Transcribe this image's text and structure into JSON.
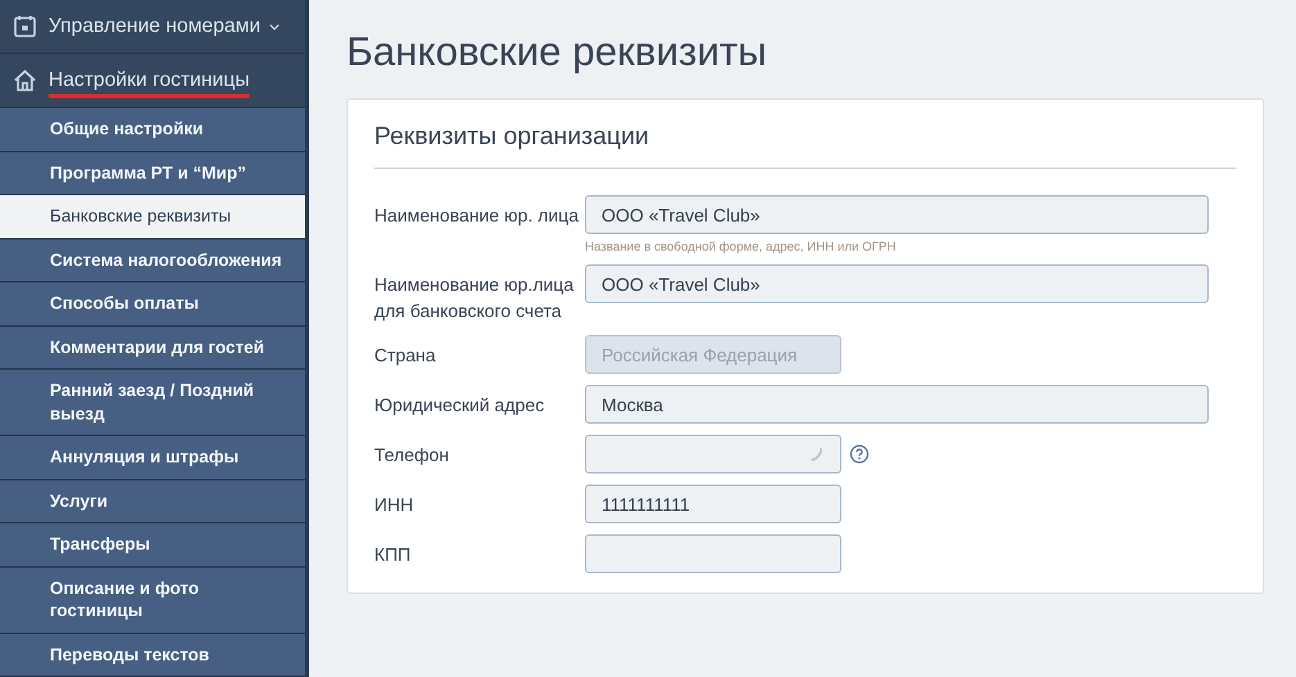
{
  "sidebar": {
    "sections": [
      {
        "label": "Управление номерами",
        "kind": "rooms",
        "expanded": false,
        "active": false
      },
      {
        "label": "Настройки гостиницы",
        "kind": "hotel",
        "expanded": true,
        "active": true
      }
    ],
    "items": [
      {
        "label": "Общие настройки",
        "selected": false
      },
      {
        "label": "Программа РТ и “Мир”",
        "selected": false
      },
      {
        "label": "Банковские реквизиты",
        "selected": true
      },
      {
        "label": "Система налогообложения",
        "selected": false
      },
      {
        "label": "Способы оплаты",
        "selected": false
      },
      {
        "label": "Комментарии для гостей",
        "selected": false
      },
      {
        "label": "Ранний заезд / Поздний выезд",
        "selected": false
      },
      {
        "label": "Аннуляция и штрафы",
        "selected": false
      },
      {
        "label": "Услуги",
        "selected": false
      },
      {
        "label": "Трансферы",
        "selected": false
      },
      {
        "label": "Описание и фото гостиницы",
        "selected": false
      },
      {
        "label": "Переводы текстов",
        "selected": false
      }
    ]
  },
  "page": {
    "title": "Банковские реквизиты"
  },
  "card": {
    "title": "Реквизиты организации",
    "fields": [
      {
        "label": "Наименование юр. лица",
        "kind": "wide",
        "value": "ООО «Travel Club»",
        "hint": "Название в свободной форме, адрес, ИНН или ОГРН",
        "disabled": false
      },
      {
        "label": "Наименование юр.лица для банковского счета",
        "kind": "wide",
        "value": "ООО «Travel Club»",
        "disabled": false
      },
      {
        "label": "Страна",
        "kind": "narrow",
        "value": "Российская Федерация",
        "disabled": true
      },
      {
        "label": "Юридический адрес",
        "kind": "wide",
        "value": "Москва",
        "disabled": false
      },
      {
        "label": "Телефон",
        "kind": "phone",
        "disabled": false
      },
      {
        "label": "ИНН",
        "kind": "narrow",
        "value": "1111111111",
        "disabled": false
      },
      {
        "label": "КПП",
        "kind": "narrow",
        "disabled": false
      }
    ]
  }
}
